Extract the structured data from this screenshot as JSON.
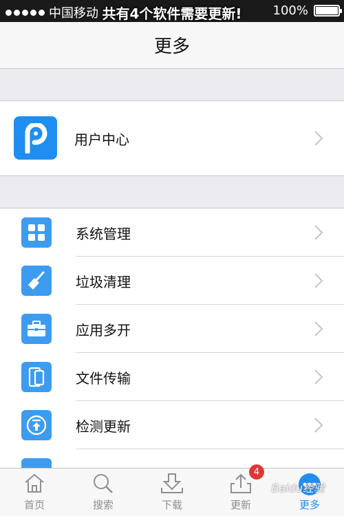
{
  "status_bar": {
    "carrier": "中国移动",
    "banner": "共有4个软件需要更新!",
    "battery": "100%"
  },
  "nav": {
    "title": "更多"
  },
  "user_center": {
    "label": "用户中心",
    "icon": "p-logo-icon"
  },
  "menu": [
    {
      "label": "系统管理",
      "icon": "grid-icon"
    },
    {
      "label": "垃圾清理",
      "icon": "broom-icon"
    },
    {
      "label": "应用多开",
      "icon": "briefcase-icon"
    },
    {
      "label": "文件传输",
      "icon": "devices-icon"
    },
    {
      "label": "检测更新",
      "icon": "update-arrow-icon"
    }
  ],
  "tabs": [
    {
      "label": "首页",
      "icon": "home-icon"
    },
    {
      "label": "搜索",
      "icon": "search-icon"
    },
    {
      "label": "下载",
      "icon": "download-icon"
    },
    {
      "label": "更新",
      "icon": "upload-icon",
      "badge": "4"
    },
    {
      "label": "更多",
      "icon": "more-icon",
      "active": true
    }
  ],
  "watermark": "Baidu经验",
  "colors": {
    "accent": "#1f8ef0",
    "icon_bg": "#3d9bf0",
    "badge": "#e23535"
  }
}
